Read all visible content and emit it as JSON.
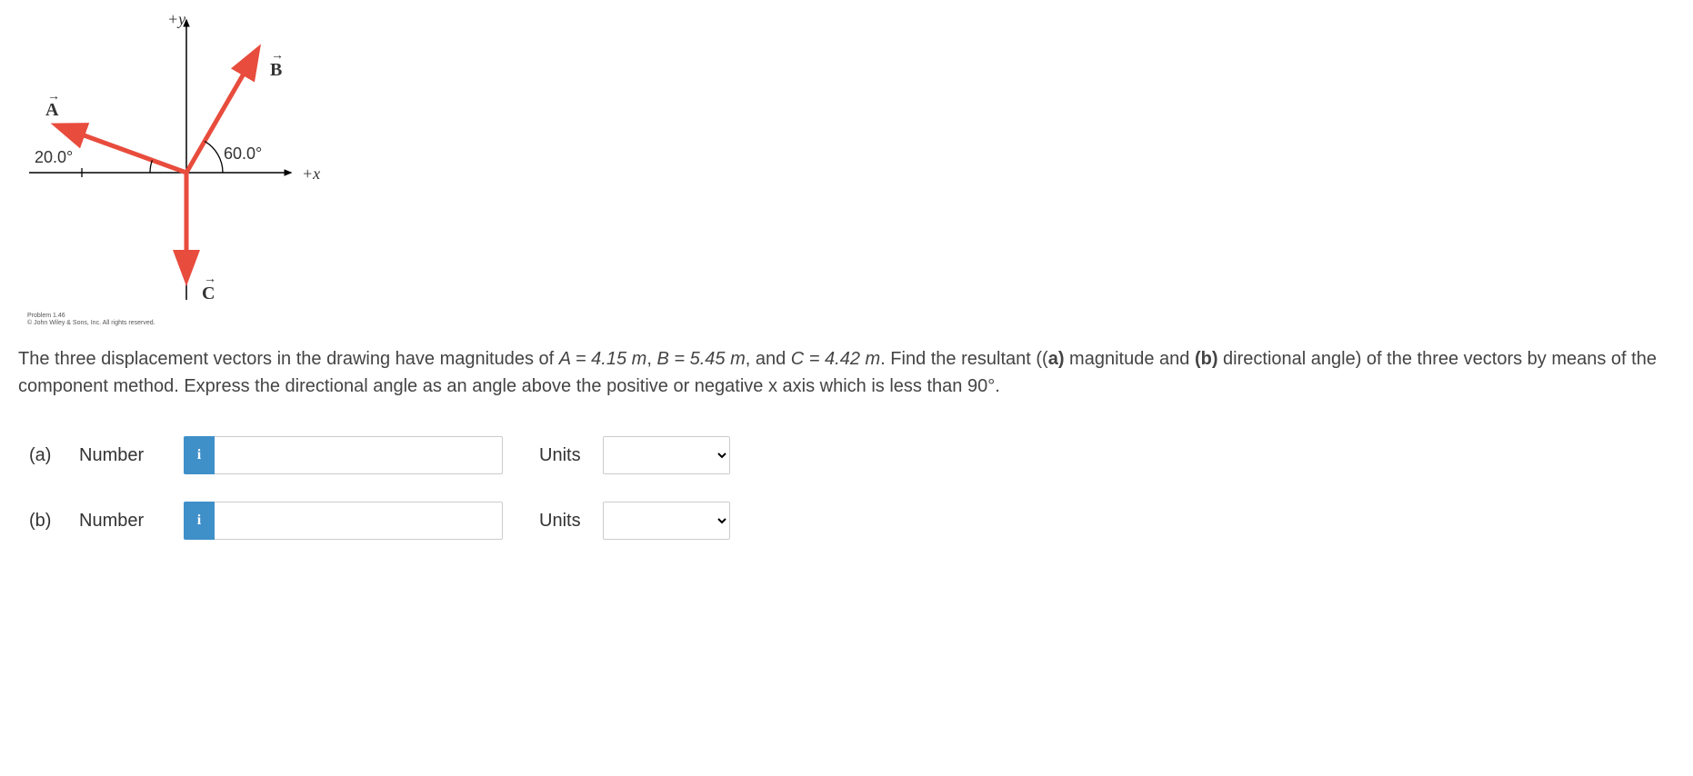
{
  "chart_data": {
    "type": "diagram",
    "title": "",
    "annotations": [
      "+y",
      "+x",
      "20.0°",
      "60.0°"
    ],
    "vectors": [
      {
        "name": "A",
        "angle_from_neg_x_deg": 20.0,
        "magnitude_m": 4.15,
        "quadrant": "II"
      },
      {
        "name": "B",
        "angle_from_pos_x_deg": 60.0,
        "magnitude_m": 5.45,
        "quadrant": "I"
      },
      {
        "name": "C",
        "angle_from_pos_x_deg": -90.0,
        "magnitude_m": 4.42,
        "direction": "-y"
      }
    ]
  },
  "diagram": {
    "labels": {
      "plus_y": "+y",
      "plus_x": "+x",
      "A": "A",
      "B": "B",
      "C": "C",
      "angle_A": "20.0°",
      "angle_B": "60.0°"
    },
    "copyright_line1": "Problem 1.46",
    "copyright_line2": "© John Wiley & Sons, Inc. All rights reserved."
  },
  "problem": {
    "intro_before_A": "The three displacement vectors in the drawing have magnitudes of ",
    "val_A": "A = 4.15 m",
    "mid_AB": ", ",
    "val_B": "B = 5.45 m",
    "mid_BC": ", and ",
    "val_C": "C = 4.42 m",
    "after_C": ". Find the resultant ((",
    "bold_a": "a)",
    "after_a": " magnitude and ",
    "bold_b": "(b)",
    "after_b": " directional angle) of the three vectors by means of the component method. Express the directional angle as an angle above the positive or negative x axis which is less than 90°."
  },
  "answers": {
    "a": {
      "part": "(a)",
      "label": "Number",
      "units_label": "Units",
      "info": "i",
      "value": "",
      "units_placeholder": ""
    },
    "b": {
      "part": "(b)",
      "label": "Number",
      "units_label": "Units",
      "info": "i",
      "value": "",
      "units_placeholder": ""
    }
  }
}
